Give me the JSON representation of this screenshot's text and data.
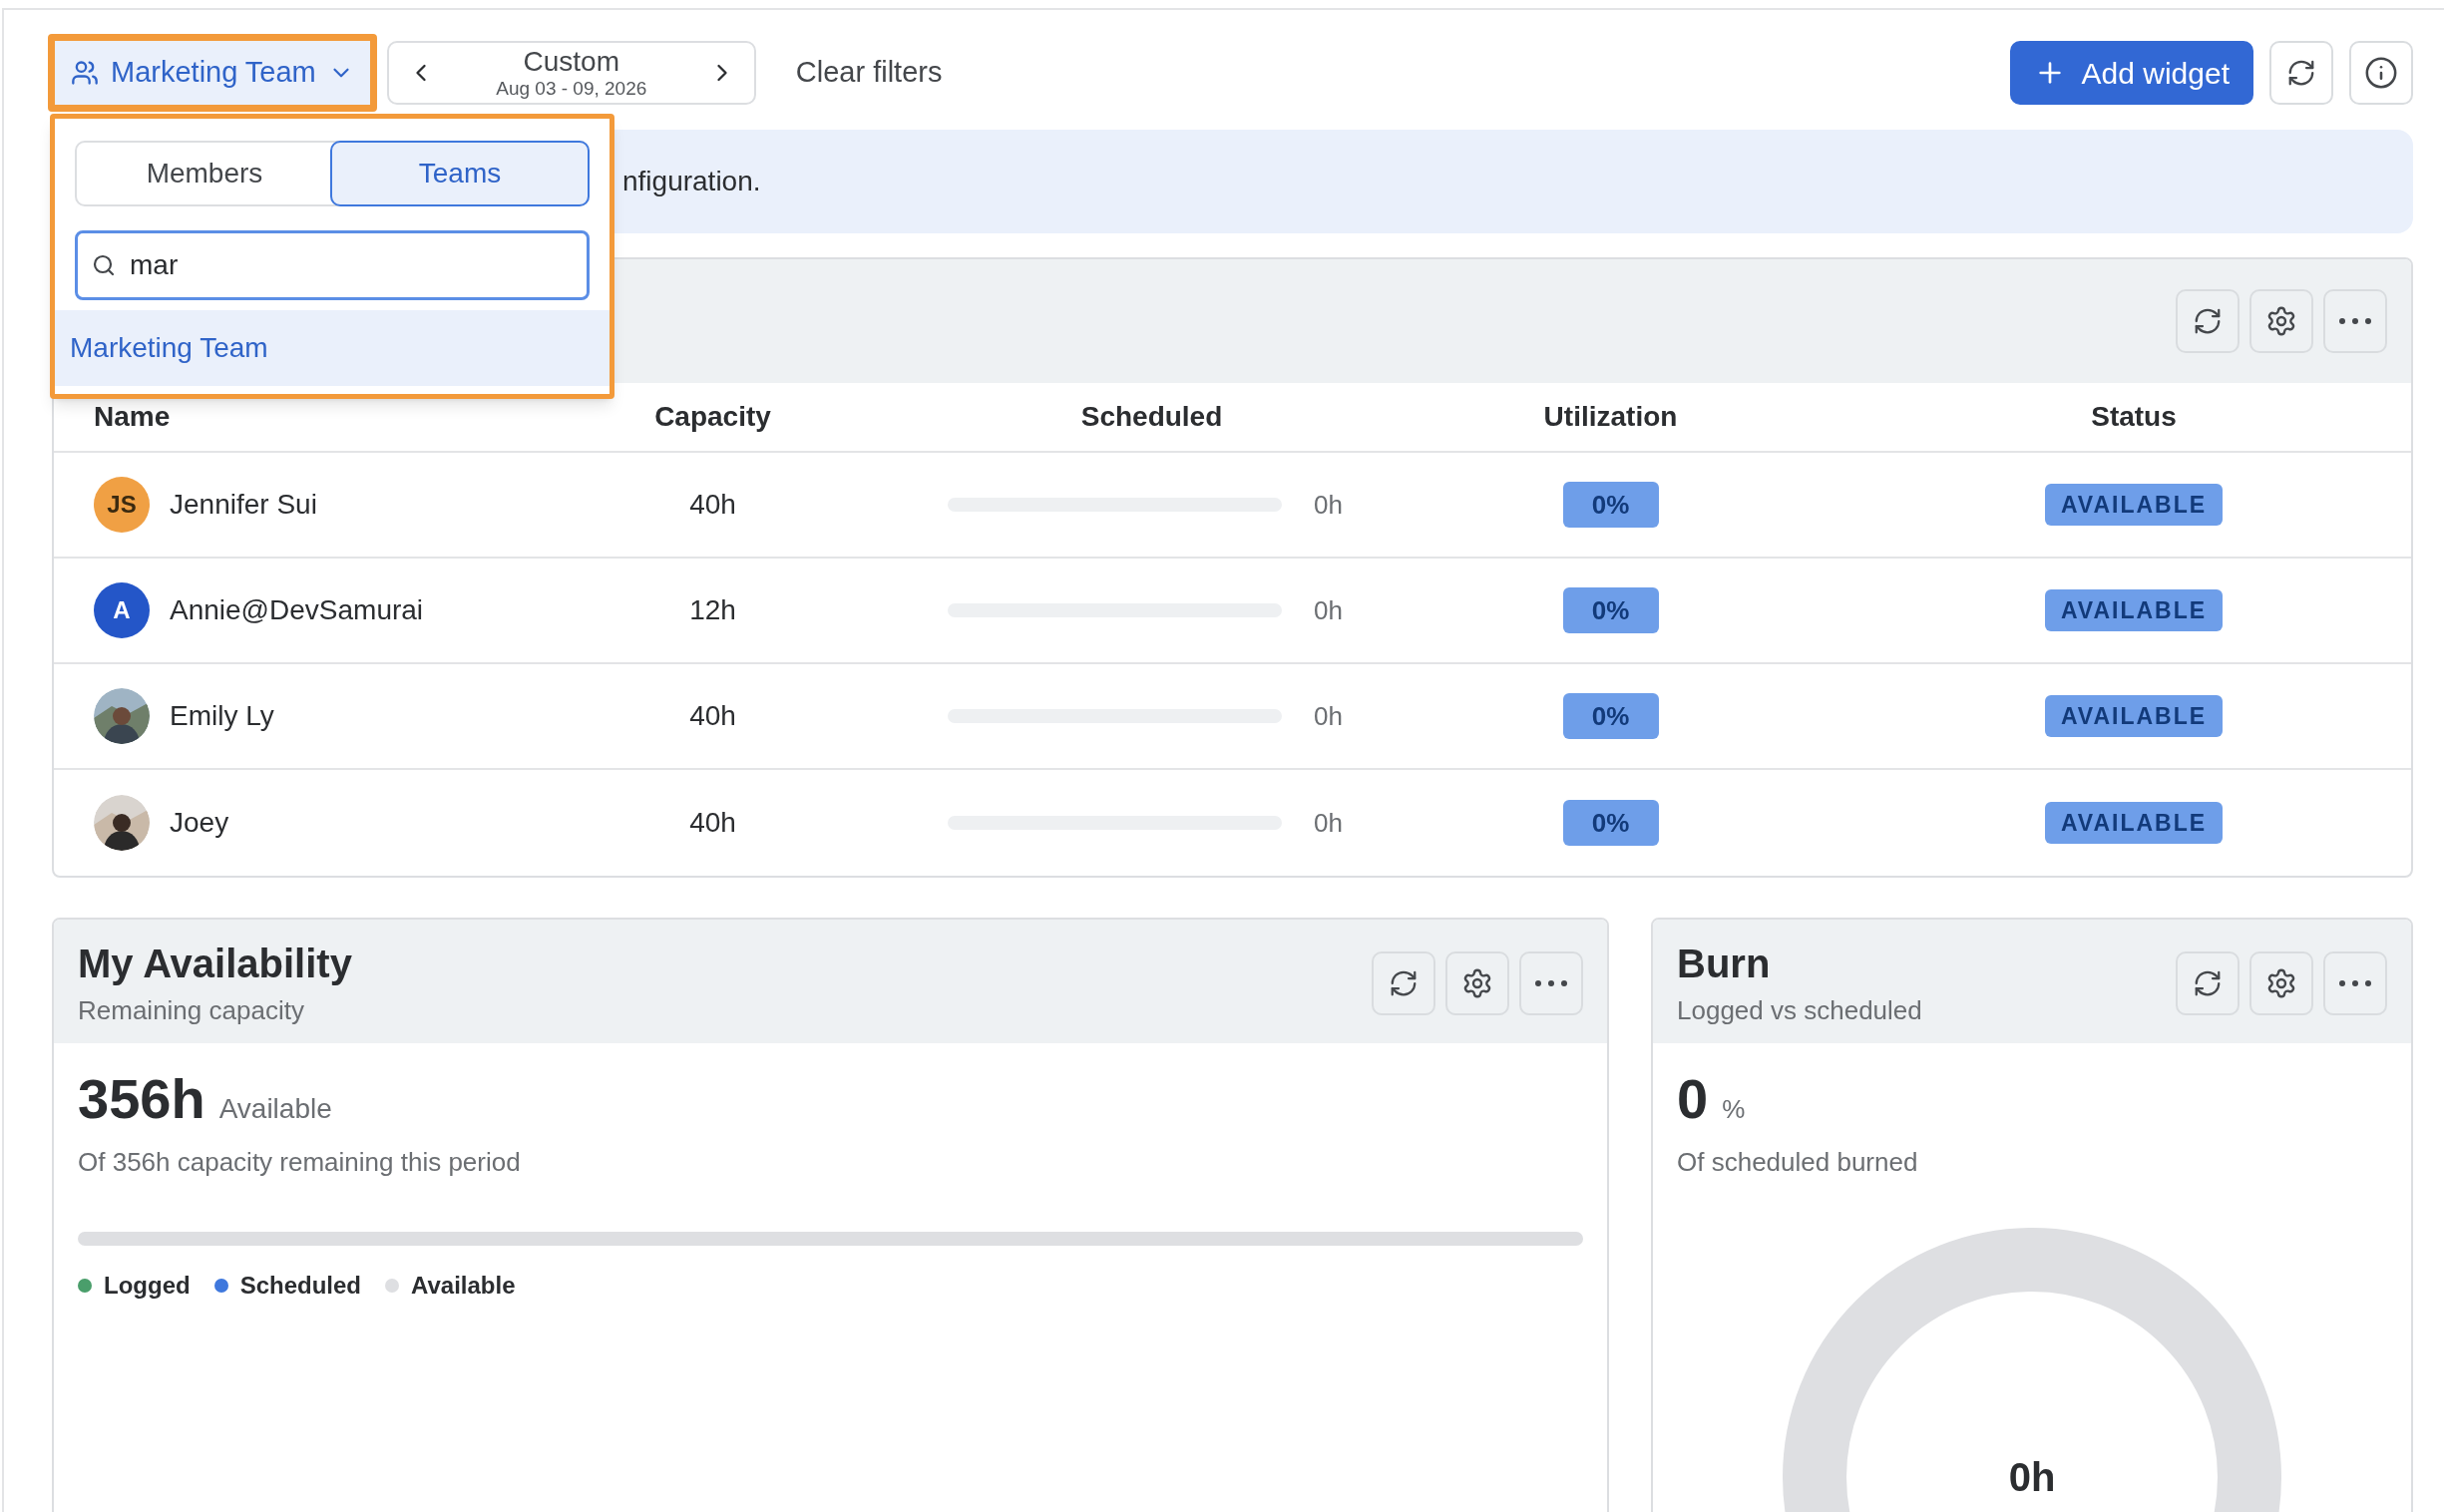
{
  "team_filter": {
    "label": "Marketing Team",
    "open": true
  },
  "date_range": {
    "label": "Custom",
    "range": "Aug 03 - 09, 2026"
  },
  "clear_filters": "Clear filters",
  "add_widget": "Add widget",
  "banner": {
    "text": "nfiguration."
  },
  "popover": {
    "tabs": [
      {
        "label": "Members",
        "selected": false
      },
      {
        "label": "Teams",
        "selected": true
      }
    ],
    "search": {
      "value": "mar"
    },
    "results": [
      {
        "label": "Marketing Team",
        "selected": true
      }
    ]
  },
  "team_table": {
    "columns": [
      "Name",
      "Capacity",
      "Scheduled",
      "Utilization",
      "Status"
    ],
    "rows": [
      {
        "name": "Jennifer Sui",
        "avatar": {
          "kind": "initials",
          "text": "JS",
          "color": "#f0a044"
        },
        "capacity": "40h",
        "scheduled": {
          "level": 0,
          "reading": "0h"
        },
        "utilization": "0%",
        "status": "AVAILABLE"
      },
      {
        "name": "Annie@DevSamurai",
        "avatar": {
          "kind": "initials",
          "text": "A",
          "color": "#2456c8"
        },
        "capacity": "12h",
        "scheduled": {
          "level": 0,
          "reading": "0h"
        },
        "utilization": "0%",
        "status": "AVAILABLE"
      },
      {
        "name": "Emily Ly",
        "capacity": "40h",
        "scheduled": {
          "level": 0,
          "reading": "0h"
        },
        "utilization": "0%",
        "status": "AVAILABLE"
      },
      {
        "name": "Joey",
        "capacity": "40h",
        "scheduled": {
          "level": 0,
          "reading": "0h"
        },
        "utilization": "0%",
        "status": "AVAILABLE"
      }
    ]
  },
  "availability": {
    "title": "My Availability",
    "subtitle": "Remaining capacity",
    "value": "356h",
    "value_label": "Available",
    "caption": "Of 356h capacity remaining this period",
    "level": 0,
    "legend": [
      {
        "label": "Logged",
        "color": "#4a9e6b"
      },
      {
        "label": "Scheduled",
        "color": "#3f78dd"
      },
      {
        "label": "Available",
        "color": "#dedfe2"
      }
    ]
  },
  "burn": {
    "title": "Burn",
    "subtitle": "Logged vs scheduled",
    "value": "0",
    "unit": "%",
    "caption": "Of scheduled burned",
    "center": "0h"
  }
}
